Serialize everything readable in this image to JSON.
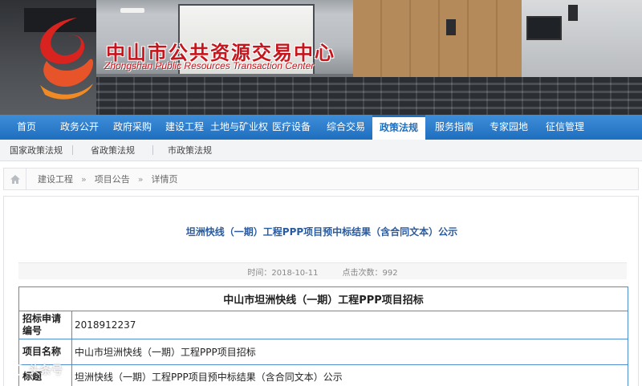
{
  "header": {
    "brand_cn": "中山市公共资源交易中心",
    "brand_en": "Zhongshan Public Resources Transaction Center",
    "brand_color": "#c5161d"
  },
  "nav": {
    "items": [
      {
        "label": "首页"
      },
      {
        "label": "政务公开"
      },
      {
        "label": "政府采购"
      },
      {
        "label": "建设工程"
      },
      {
        "label": "土地与矿业权"
      },
      {
        "label": "医疗设备"
      },
      {
        "label": "综合交易"
      },
      {
        "label": "政策法规"
      },
      {
        "label": "服务指南"
      },
      {
        "label": "专家园地"
      },
      {
        "label": "征信管理"
      }
    ],
    "active_label": "政策法规",
    "bar_color": "#1f6fbf"
  },
  "subnav": {
    "items": [
      {
        "label": "国家政策法规"
      },
      {
        "label": "省政策法规"
      },
      {
        "label": "市政策法规"
      }
    ]
  },
  "breadcrumb": {
    "home_icon": "home-icon",
    "items": [
      {
        "label": "建设工程"
      },
      {
        "label": "项目公告"
      },
      {
        "label": "详情页"
      }
    ],
    "separator": "»"
  },
  "article": {
    "title": "坦洲快线（一期）工程PPP项目预中标结果（含合同文本）公示",
    "time_label": "时间：",
    "time_value": "2018-10-11",
    "clicks_label": "点击次数：",
    "clicks_value": "992",
    "table": {
      "heading": "中山市坦洲快线（一期）工程PPP项目招标",
      "rows": [
        {
          "label": "招标申请编号",
          "value": "2018912237"
        },
        {
          "label": "项目名称",
          "value": "中山市坦洲快线（一期）工程PPP项目招标"
        },
        {
          "label": "标题",
          "value": "坦洲快线（一期）工程PPP项目预中标结果（含合同文本）公示"
        }
      ]
    }
  },
  "watermark": {
    "text": "头条号"
  }
}
